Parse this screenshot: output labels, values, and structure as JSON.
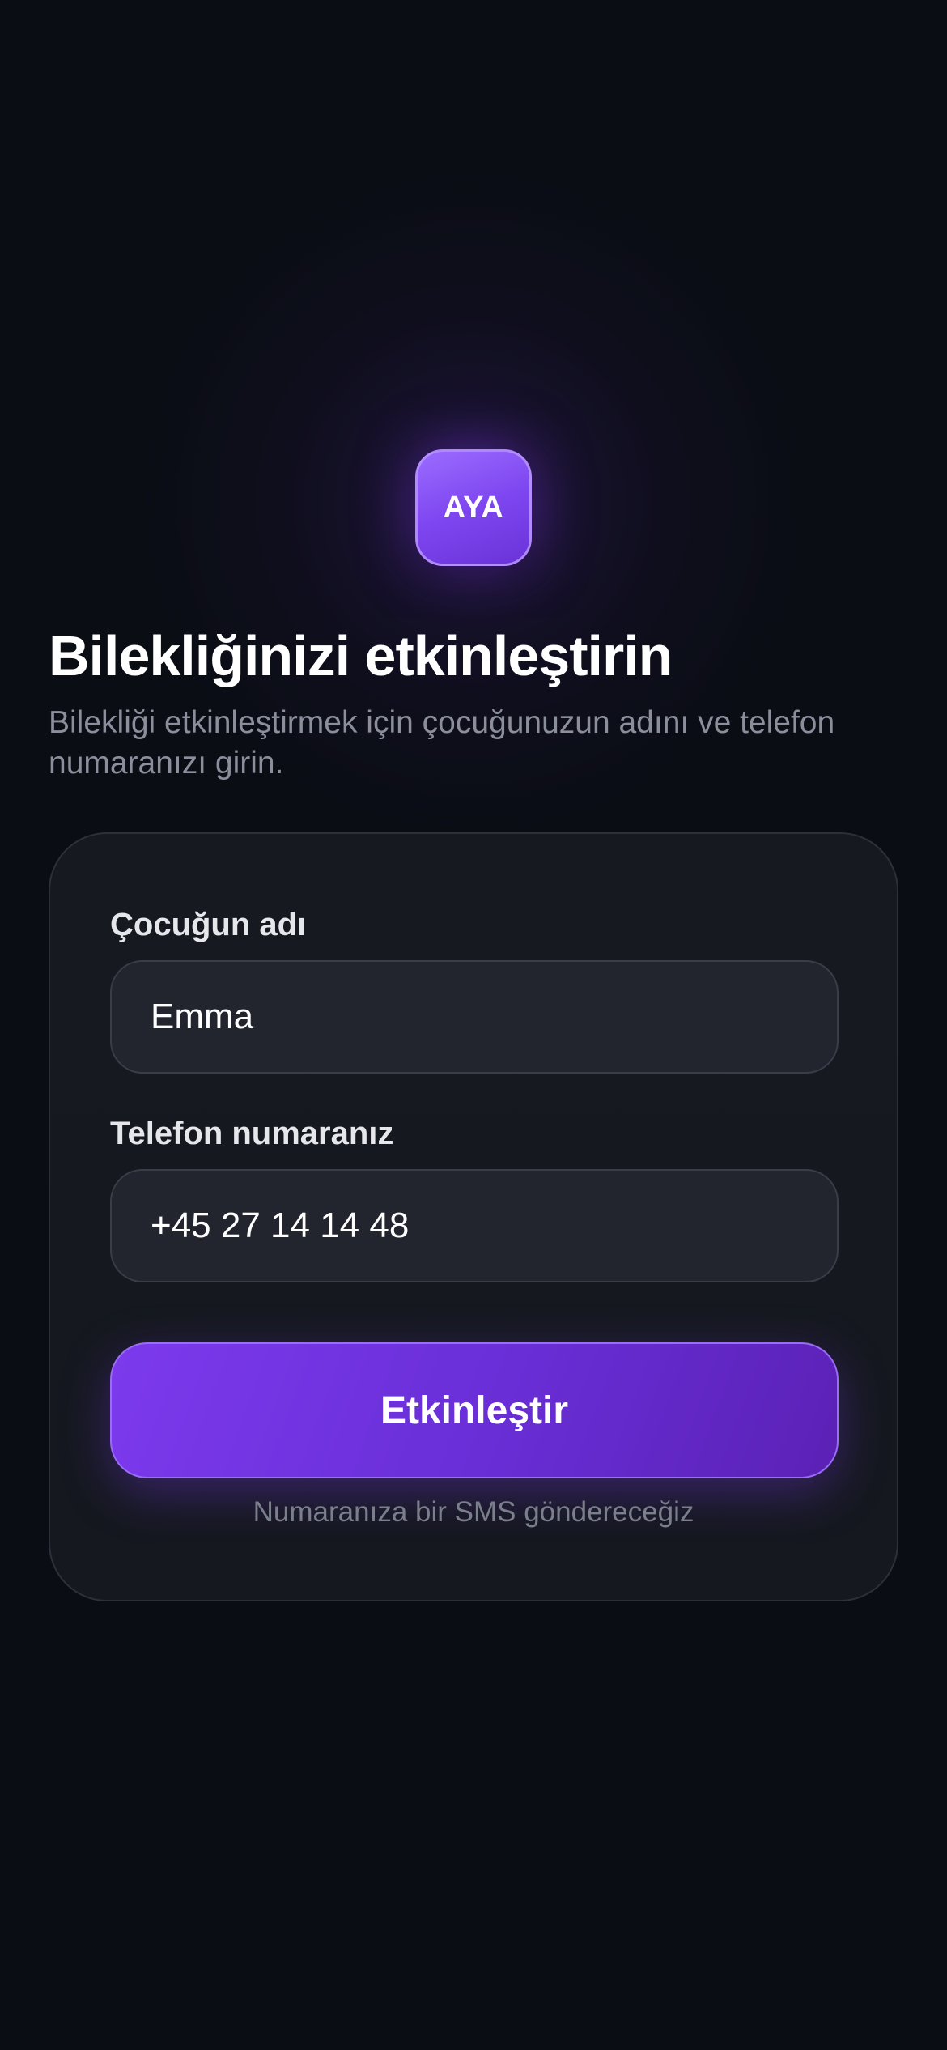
{
  "logo": {
    "text": "AYA"
  },
  "header": {
    "title": "Bilekliğinizi etkinleştirin",
    "subtitle": "Bilekliği etkinleştirmek için çocuğunuzun adını ve telefon numaranızı girin."
  },
  "form": {
    "child_name": {
      "label": "Çocuğun adı",
      "value": "Emma"
    },
    "phone": {
      "label": "Telefon numaranız",
      "value": "+45 27 14 14 48"
    },
    "submit_label": "Etkinleştir",
    "hint": "Numaranıza bir SMS göndereceğiz"
  },
  "colors": {
    "background": "#0a0d14",
    "card": "#161920",
    "input": "#22252d",
    "accent": "#7c3aed",
    "accent_dark": "#5b21b6",
    "muted_text": "#8b8f9c"
  }
}
